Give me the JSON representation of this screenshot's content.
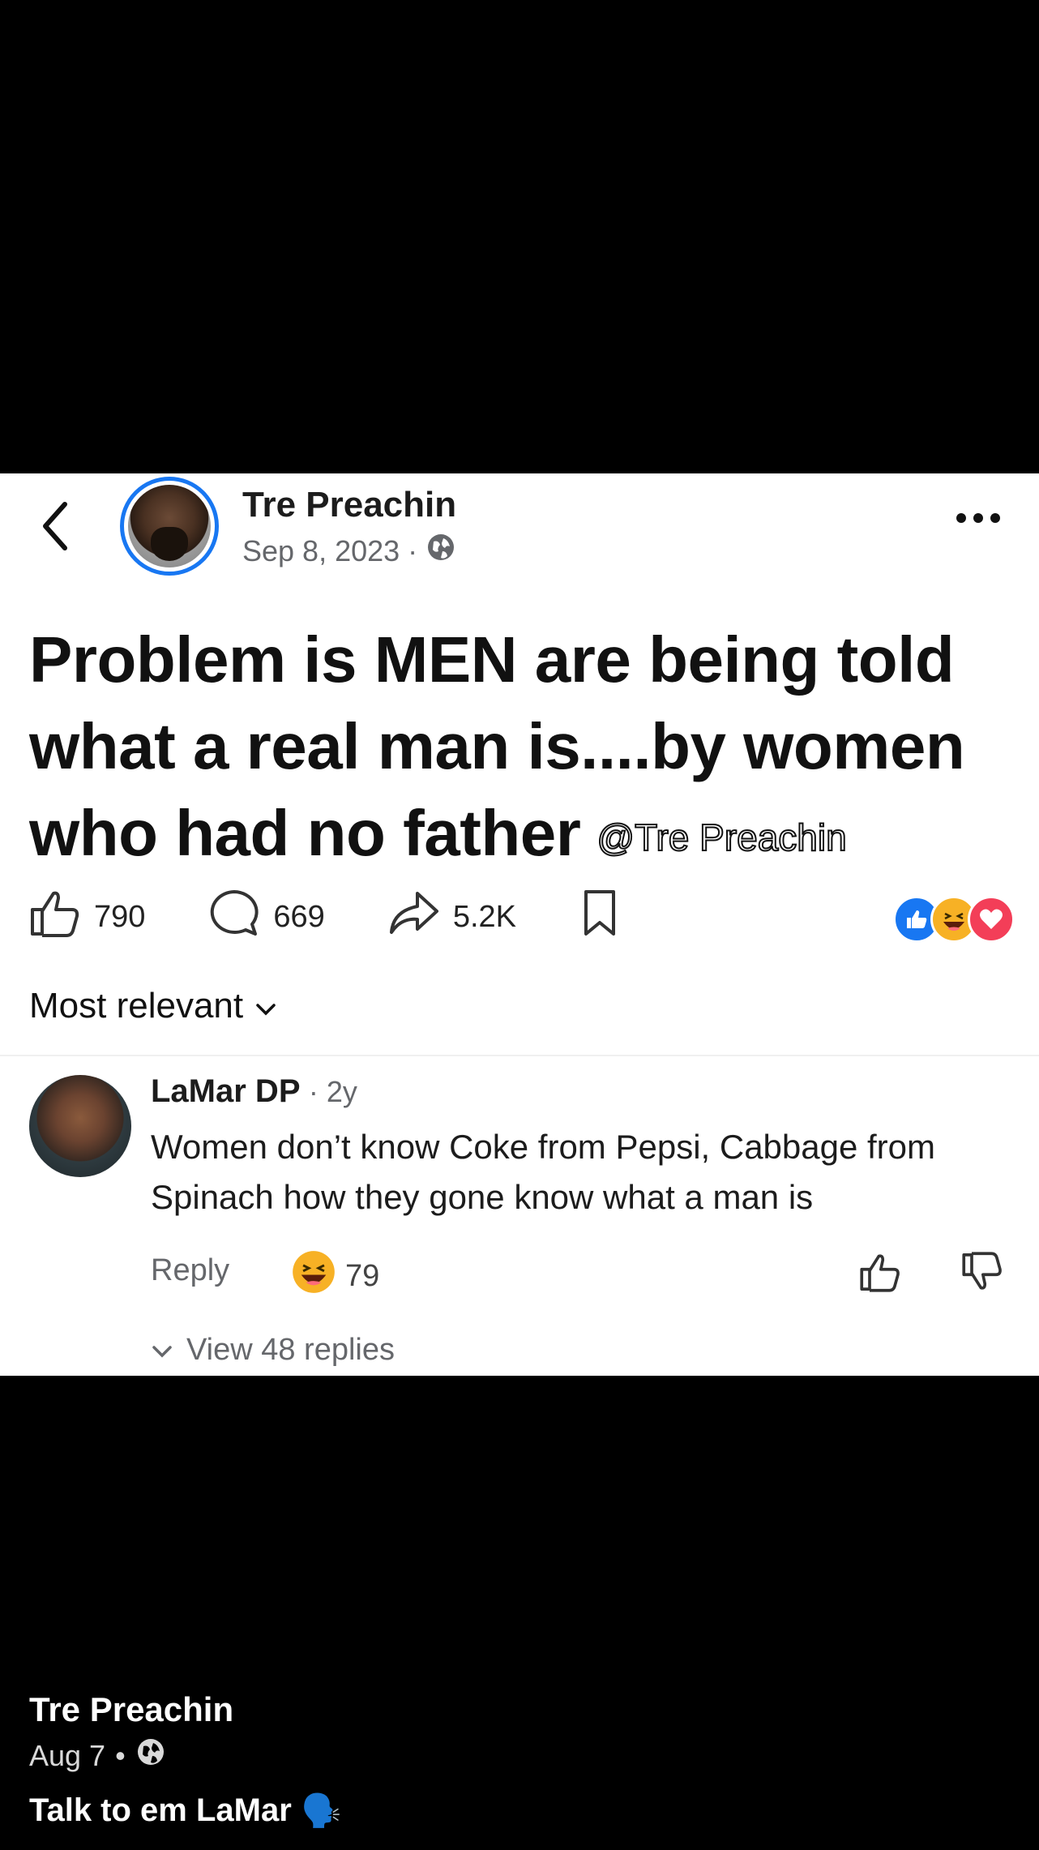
{
  "post": {
    "author": "Tre Preachin",
    "date": "Sep 8, 2023",
    "separator": "·",
    "text": "Problem is MEN are being told what a real man is....by women who had no father",
    "watermark": "@Tre Preachin",
    "likes": "790",
    "comments": "669",
    "shares": "5.2K"
  },
  "sort": {
    "label": "Most relevant"
  },
  "comment": {
    "author": "LaMar DP",
    "age": "· 2y",
    "text": "Women don’t know Coke from Pepsi, Cabbage from Spinach how they gone know what a man is",
    "reply_label": "Reply",
    "reaction_count": "79",
    "view_replies": "View 48 replies"
  },
  "caption": {
    "author": "Tre Preachin",
    "date": "Aug 7",
    "dot": "•",
    "text": "Talk to em LaMar",
    "emoji": "🗣️"
  },
  "colors": {
    "accent": "#1877f2",
    "muted": "#65676b",
    "like_blue": "#1877f2",
    "love_red": "#f33e58",
    "haha_yellow": "#f7b125"
  },
  "icons": [
    "back-chevron-icon",
    "globe-icon",
    "more-dots-icon",
    "thumbs-up-icon",
    "comment-bubble-icon",
    "share-arrow-icon",
    "bookmark-icon",
    "like-reaction-icon",
    "haha-reaction-icon",
    "love-reaction-icon",
    "chevron-down-icon",
    "thumbs-down-icon"
  ]
}
